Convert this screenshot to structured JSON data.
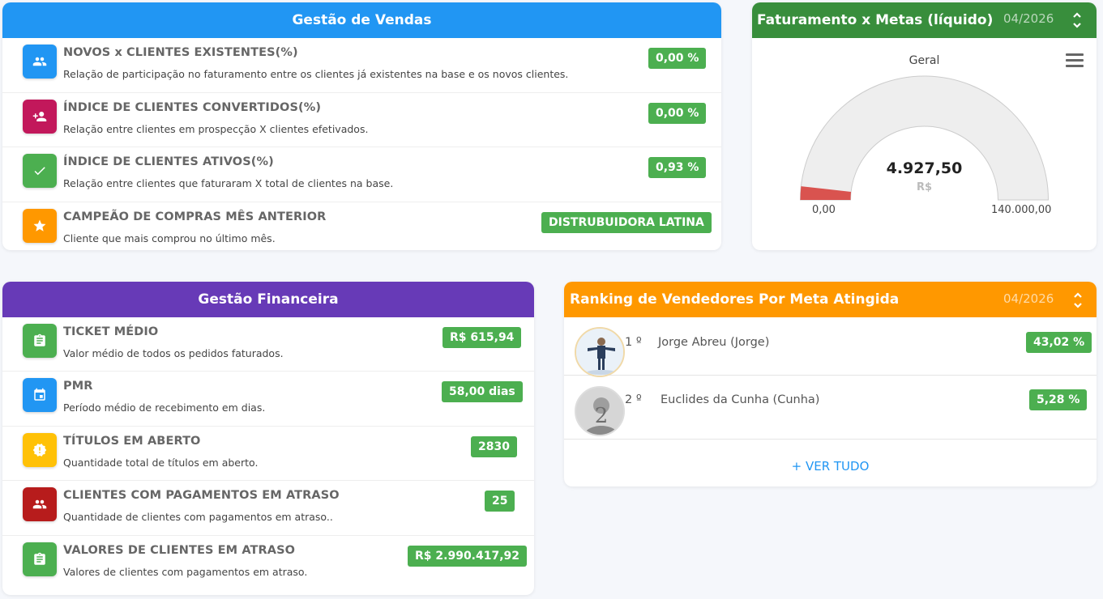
{
  "vendas": {
    "title": "Gestão de Vendas",
    "rows": [
      {
        "title": "NOVOS x CLIENTES EXISTENTES(%)",
        "desc": "Relação de participação no faturamento entre os clientes já existentes na base e os novos clientes.",
        "value": "0,00 %",
        "icon": "group-icon",
        "color": "#2196f3"
      },
      {
        "title": "ÍNDICE DE CLIENTES CONVERTIDOS(%)",
        "desc": "Relação entre clientes em prospecção X clientes efetivados.",
        "value": "0,00 %",
        "icon": "person-add-icon",
        "color": "#c2185b"
      },
      {
        "title": "ÍNDICE DE CLIENTES ATIVOS(%)",
        "desc": "Relação entre clientes que faturaram X total de clientes na base.",
        "value": "0,93 %",
        "icon": "check-icon",
        "color": "#4caf50"
      },
      {
        "title": "CAMPEÃO DE COMPRAS MÊS ANTERIOR",
        "desc": "Cliente que mais comprou no último mês.",
        "value": "DISTRUBUIDORA LATINA",
        "icon": "star-icon",
        "color": "#ff9800"
      }
    ]
  },
  "financeira": {
    "title": "Gestão Financeira",
    "rows": [
      {
        "title": "TICKET MÉDIO",
        "desc": "Valor médio de todos os pedidos faturados.",
        "value": "R$ 615,94",
        "icon": "clipboard-icon",
        "color": "#4caf50"
      },
      {
        "title": "PMR",
        "desc": "Período médio de recebimento em dias.",
        "value": "58,00 dias",
        "icon": "calendar-icon",
        "color": "#2196f3"
      },
      {
        "title": "TÍTULOS EM ABERTO",
        "desc": "Quantidade total de títulos em aberto.",
        "value": "2830",
        "icon": "alert-icon",
        "color": "#ffc107"
      },
      {
        "title": "CLIENTES COM PAGAMENTOS EM ATRASO",
        "desc": "Quantidade de clientes com pagamentos em atraso..",
        "value": "25",
        "icon": "group-icon",
        "color": "#b71c1c"
      },
      {
        "title": "VALORES DE CLIENTES EM ATRASO",
        "desc": "Valores de clientes com pagamentos em atraso.",
        "value": "R$ 2.990.417,92",
        "icon": "clipboard-icon",
        "color": "#4caf50"
      }
    ]
  },
  "gauge": {
    "title": "Faturamento x Metas (líquido)",
    "period": "04/2026",
    "label": "Geral",
    "value_text": "4.927,50",
    "unit": "R$",
    "min_text": "0,00",
    "max_text": "140.000,00",
    "value": 4927.5,
    "min": 0,
    "max": 140000,
    "fill_color": "#d9534f",
    "track_color": "#eeeeee"
  },
  "ranking": {
    "title": "Ranking de Vendedores Por Meta Atingida",
    "period": "04/2026",
    "items": [
      {
        "pos": "1 º",
        "name": "Jorge Abreu (Jorge)",
        "value": "43,02 %"
      },
      {
        "pos": "2 º",
        "name": "Euclides da Cunha (Cunha)",
        "value": "5,28 %"
      }
    ],
    "ver_tudo": "VER TUDO",
    "ver_tudo_prefix": "+"
  }
}
